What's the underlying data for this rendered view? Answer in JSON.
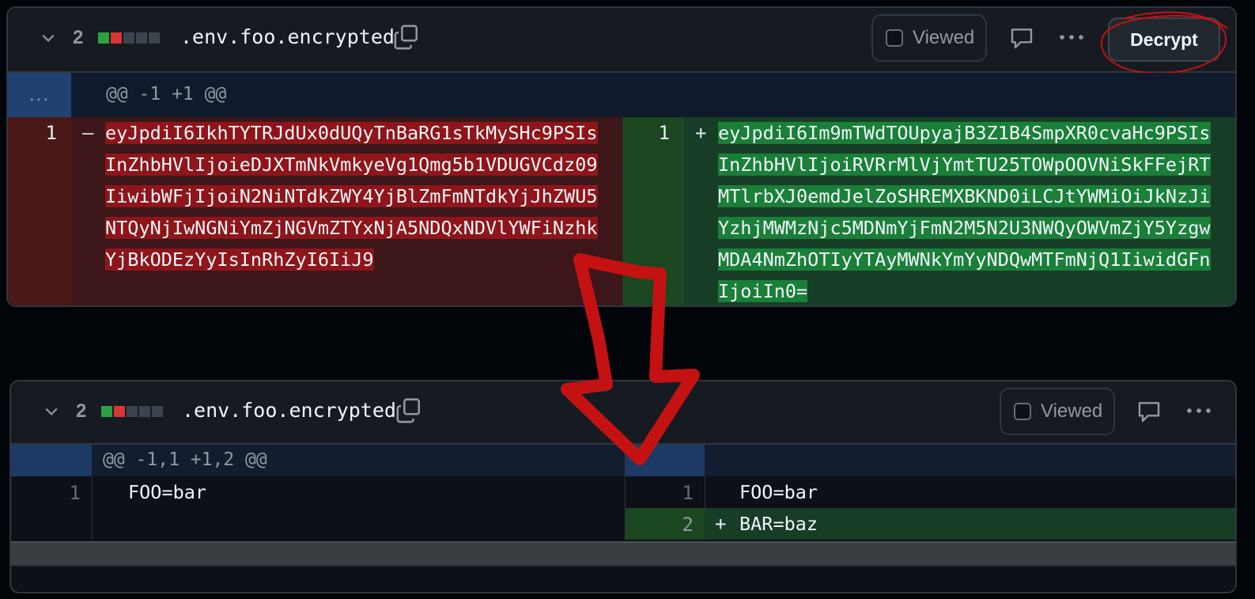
{
  "top_file": {
    "change_count": "2",
    "filename": ".env.foo.encrypted",
    "viewed_label": "Viewed",
    "decrypt_label": "Decrypt",
    "expand_label": "...",
    "hunk_header": "@@ -1 +1 @@",
    "left_line_number": "1",
    "left_marker": "–",
    "right_line_number": "1",
    "right_marker": "+",
    "left_lines": [
      "eyJpdiI6IkhTYTRJdUx0dUQyTnBaRG1sTkMySHc9PSIs",
      "InZhbHVlIjoieDJXTmNkVmkyeVg1Qmg5b1VDUGVCdz09",
      "IiwibWFjIjoiN2NiNTdkZWY4YjBlZmFmNTdkYjJhZWU5",
      "NTQyNjIwNGNiYmZjNGVmZTYxNjA5NDQxNDVlYWFiNzhk",
      "YjBkODEzYyIsInRhZyI6IiJ9"
    ],
    "right_lines": [
      "eyJpdiI6Im9mTWdTOUpyajB3Z1B4SmpXR0cvaHc9PSIs",
      "InZhbHVlIjoiRVRrMlVjYmtTU25TOWpOOVNiSkFFejRT",
      "MTlrbXJ0emdJelZoSHREMXBKND0iLCJtYWMiOiJkNzJi",
      "YzhjMWMzNjc5MDNmYjFmN2M5N2U3NWQyOWVmZjY5Yzgw",
      "MDA4NmZhOTIyYTAyMWNkYmYyNDQwMTFmNjQ1IiwidGFn",
      "IjoiIn0="
    ]
  },
  "bottom_file": {
    "change_count": "2",
    "filename": ".env.foo.encrypted",
    "viewed_label": "Viewed",
    "hunk_header": "@@ -1,1 +1,2 @@",
    "left_rows": [
      {
        "num": "1",
        "marker": "",
        "code": "FOO=bar"
      }
    ],
    "right_rows": [
      {
        "num": "1",
        "marker": "",
        "code": "FOO=bar"
      },
      {
        "num": "2",
        "marker": "+",
        "code": "BAR=baz"
      }
    ]
  },
  "colors": {
    "deleted_bg": "#4b1818",
    "deleted_highlight": "#8e1519",
    "added_bg": "#173d26",
    "added_highlight": "#1a7f37",
    "annotation_red": "#c41212"
  },
  "icons": [
    "chevron-down-icon",
    "copy-icon",
    "comment-icon",
    "kebab-horizontal-icon",
    "checkbox-icon"
  ]
}
